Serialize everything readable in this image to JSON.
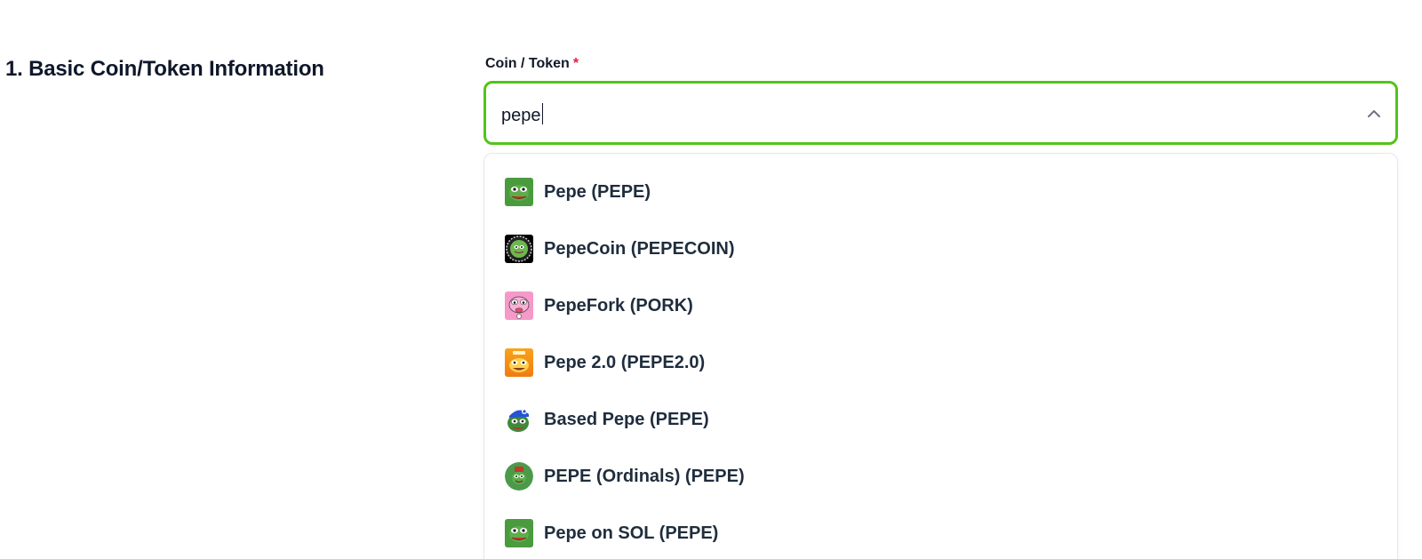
{
  "section": {
    "title": "1. Basic Coin/Token Information"
  },
  "field": {
    "label": "Coin / Token",
    "required_mark": "*",
    "value": "pepe",
    "border_color": "#52c41a"
  },
  "dropdown": {
    "options": [
      {
        "label": "Pepe (PEPE)",
        "icon": "pepe-frog-icon"
      },
      {
        "label": "PepeCoin (PEPECOIN)",
        "icon": "pepecoin-icon"
      },
      {
        "label": "PepeFork (PORK)",
        "icon": "pepefork-icon"
      },
      {
        "label": "Pepe 2.0 (PEPE2.0)",
        "icon": "pepe2-icon"
      },
      {
        "label": "Based Pepe (PEPE)",
        "icon": "based-pepe-icon"
      },
      {
        "label": "PEPE (Ordinals) (PEPE)",
        "icon": "pepe-ordinals-icon"
      },
      {
        "label": "Pepe on SOL (PEPE)",
        "icon": "pepe-sol-icon"
      }
    ]
  }
}
